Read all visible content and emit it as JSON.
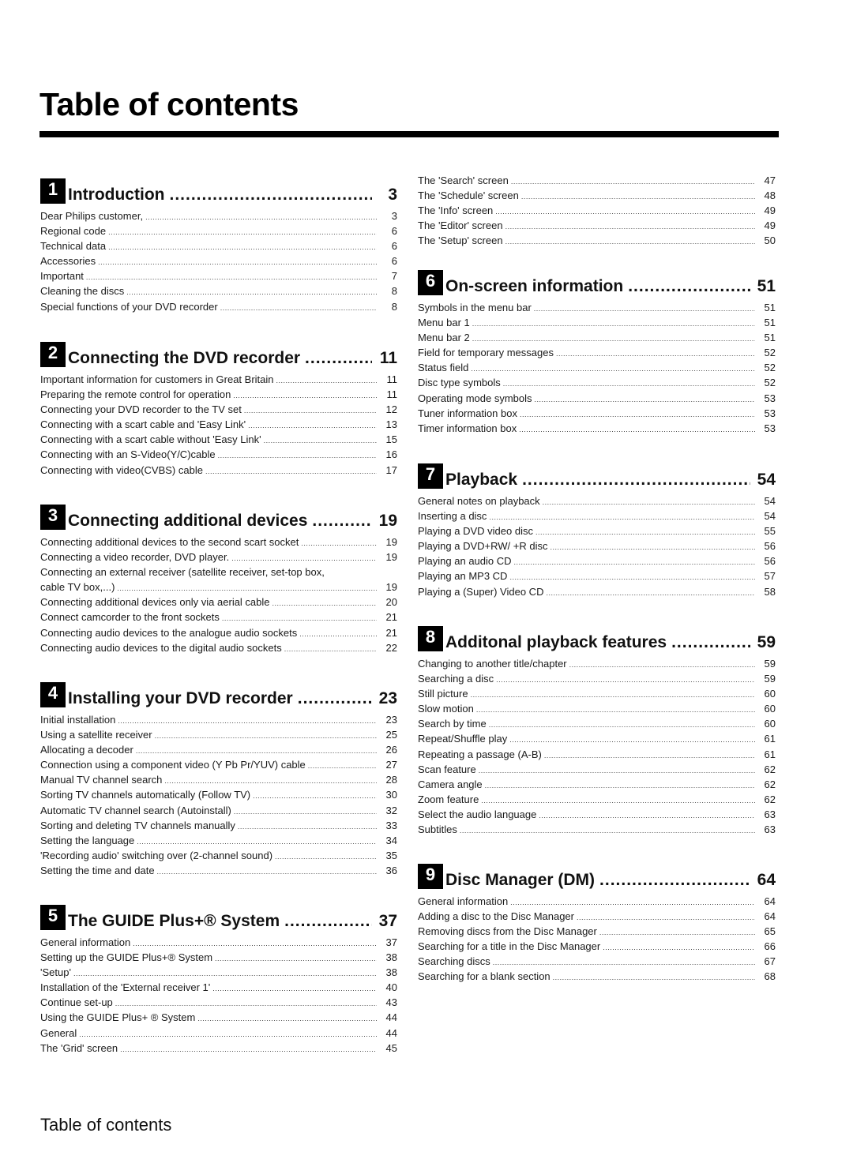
{
  "page": {
    "title": "Table of contents",
    "footer": "Table of contents"
  },
  "sections": [
    {
      "number": "1",
      "title": "Introduction",
      "page": "3",
      "entries": [
        {
          "label": "Dear Philips customer,",
          "page": "3"
        },
        {
          "label": "Regional code",
          "page": "6"
        },
        {
          "label": "Technical data",
          "page": "6"
        },
        {
          "label": "Accessories",
          "page": "6"
        },
        {
          "label": "Important",
          "page": "7"
        },
        {
          "label": "Cleaning the discs",
          "page": "8"
        },
        {
          "label": "Special functions of your DVD recorder",
          "page": "8"
        }
      ]
    },
    {
      "number": "2",
      "title": "Connecting the DVD recorder",
      "page": "11",
      "entries": [
        {
          "label": "Important information for customers in Great Britain",
          "page": "11"
        },
        {
          "label": "Preparing the remote control for operation",
          "page": "11"
        },
        {
          "label": "Connecting your DVD recorder to the TV set",
          "page": "12"
        },
        {
          "label": "Connecting with a scart cable and 'Easy Link'",
          "page": "13"
        },
        {
          "label": "Connecting with a scart cable without 'Easy Link'",
          "page": "15"
        },
        {
          "label": "Connecting with an S-Video(Y/C)cable",
          "page": "16"
        },
        {
          "label": "Connecting with video(CVBS) cable",
          "page": "17"
        }
      ]
    },
    {
      "number": "3",
      "title": "Connecting additional devices",
      "page": "19",
      "entries": [
        {
          "label": "Connecting additional devices to the second scart socket",
          "page": "19"
        },
        {
          "label": "Connecting a video recorder, DVD player.",
          "page": "19"
        },
        {
          "label": "Connecting an external receiver (satellite receiver, set-top box,",
          "page": ""
        },
        {
          "label": "cable TV box,...)",
          "page": "19"
        },
        {
          "label": "Connecting additional devices only via aerial cable",
          "page": "20"
        },
        {
          "label": "Connect camcorder to the front sockets",
          "page": "21"
        },
        {
          "label": "Connecting audio devices to the analogue audio sockets",
          "page": "21"
        },
        {
          "label": "Connecting audio devices to the digital audio sockets",
          "page": "22"
        }
      ]
    },
    {
      "number": "4",
      "title": "Installing your DVD recorder",
      "page": "23",
      "entries": [
        {
          "label": "Initial installation",
          "page": "23"
        },
        {
          "label": "Using a satellite receiver",
          "page": "25"
        },
        {
          "label": "Allocating a decoder",
          "page": "26"
        },
        {
          "label": "Connection using a component video (Y Pb Pr/YUV) cable",
          "page": "27"
        },
        {
          "label": "Manual TV channel search",
          "page": "28"
        },
        {
          "label": "Sorting TV channels automatically (Follow TV)",
          "page": "30"
        },
        {
          "label": "Automatic TV channel search (Autoinstall)",
          "page": "32"
        },
        {
          "label": "Sorting and deleting TV channels manually",
          "page": "33"
        },
        {
          "label": "Setting the language",
          "page": "34"
        },
        {
          "label": "'Recording audio' switching over (2-channel sound)",
          "page": "35"
        },
        {
          "label": "Setting the time and date",
          "page": "36"
        }
      ]
    },
    {
      "number": "5",
      "title": "The GUIDE Plus+® System",
      "page": "37",
      "entries": [
        {
          "label": "General information",
          "page": "37"
        },
        {
          "label": "Setting up the GUIDE Plus+® System",
          "page": "38"
        },
        {
          "label": "'Setup'",
          "page": "38"
        },
        {
          "label": "Installation of the 'External receiver 1'",
          "page": "40"
        },
        {
          "label": "Continue set-up",
          "page": "43"
        },
        {
          "label": "Using the GUIDE Plus+ ® System",
          "page": "44"
        },
        {
          "label": "General",
          "page": "44"
        },
        {
          "label": "The 'Grid' screen",
          "page": "45"
        },
        {
          "label": "The 'Search' screen",
          "page": "47"
        },
        {
          "label": "The 'Schedule' screen",
          "page": "48"
        },
        {
          "label": "The 'Info' screen",
          "page": "49"
        },
        {
          "label": "The 'Editor' screen",
          "page": "49"
        },
        {
          "label": "The 'Setup' screen",
          "page": "50"
        }
      ]
    },
    {
      "number": "6",
      "title": "On-screen information",
      "page": "51",
      "entries": [
        {
          "label": "Symbols in the menu bar",
          "page": "51"
        },
        {
          "label": "Menu bar 1",
          "page": "51"
        },
        {
          "label": "Menu bar 2",
          "page": "51"
        },
        {
          "label": "Field for temporary messages",
          "page": "52"
        },
        {
          "label": "Status field",
          "page": "52"
        },
        {
          "label": "Disc type symbols",
          "page": "52"
        },
        {
          "label": "Operating mode symbols",
          "page": "53"
        },
        {
          "label": "Tuner information box",
          "page": "53"
        },
        {
          "label": "Timer information box",
          "page": "53"
        }
      ]
    },
    {
      "number": "7",
      "title": "Playback",
      "page": "54",
      "entries": [
        {
          "label": "General notes on playback",
          "page": "54"
        },
        {
          "label": "Inserting a disc",
          "page": "54"
        },
        {
          "label": "Playing a DVD video disc",
          "page": "55"
        },
        {
          "label": "Playing a DVD+RW/ +R disc",
          "page": "56"
        },
        {
          "label": "Playing an audio CD",
          "page": "56"
        },
        {
          "label": "Playing an MP3 CD",
          "page": "57"
        },
        {
          "label": "Playing a (Super) Video CD",
          "page": "58"
        }
      ]
    },
    {
      "number": "8",
      "title": "Additonal playback features",
      "page": "59",
      "entries": [
        {
          "label": "Changing to another title/chapter",
          "page": "59"
        },
        {
          "label": "Searching a disc",
          "page": "59"
        },
        {
          "label": "Still picture",
          "page": "60"
        },
        {
          "label": "Slow motion",
          "page": "60"
        },
        {
          "label": "Search by time",
          "page": "60"
        },
        {
          "label": "Repeat/Shuffle play",
          "page": "61"
        },
        {
          "label": "Repeating a passage (A-B)",
          "page": "61"
        },
        {
          "label": "Scan feature",
          "page": "62"
        },
        {
          "label": "Camera angle",
          "page": "62"
        },
        {
          "label": "Zoom feature",
          "page": "62"
        },
        {
          "label": "Select the audio language",
          "page": "63"
        },
        {
          "label": "Subtitles",
          "page": "63"
        }
      ]
    },
    {
      "number": "9",
      "title": "Disc Manager (DM)",
      "page": "64",
      "entries": [
        {
          "label": "General information",
          "page": "64"
        },
        {
          "label": "Adding a disc to the Disc Manager",
          "page": "64"
        },
        {
          "label": "Removing discs from the Disc Manager",
          "page": "65"
        },
        {
          "label": "Searching for a title in the Disc Manager",
          "page": "66"
        },
        {
          "label": "Searching discs",
          "page": "67"
        },
        {
          "label": "Searching for a blank section",
          "page": "68"
        }
      ]
    }
  ]
}
